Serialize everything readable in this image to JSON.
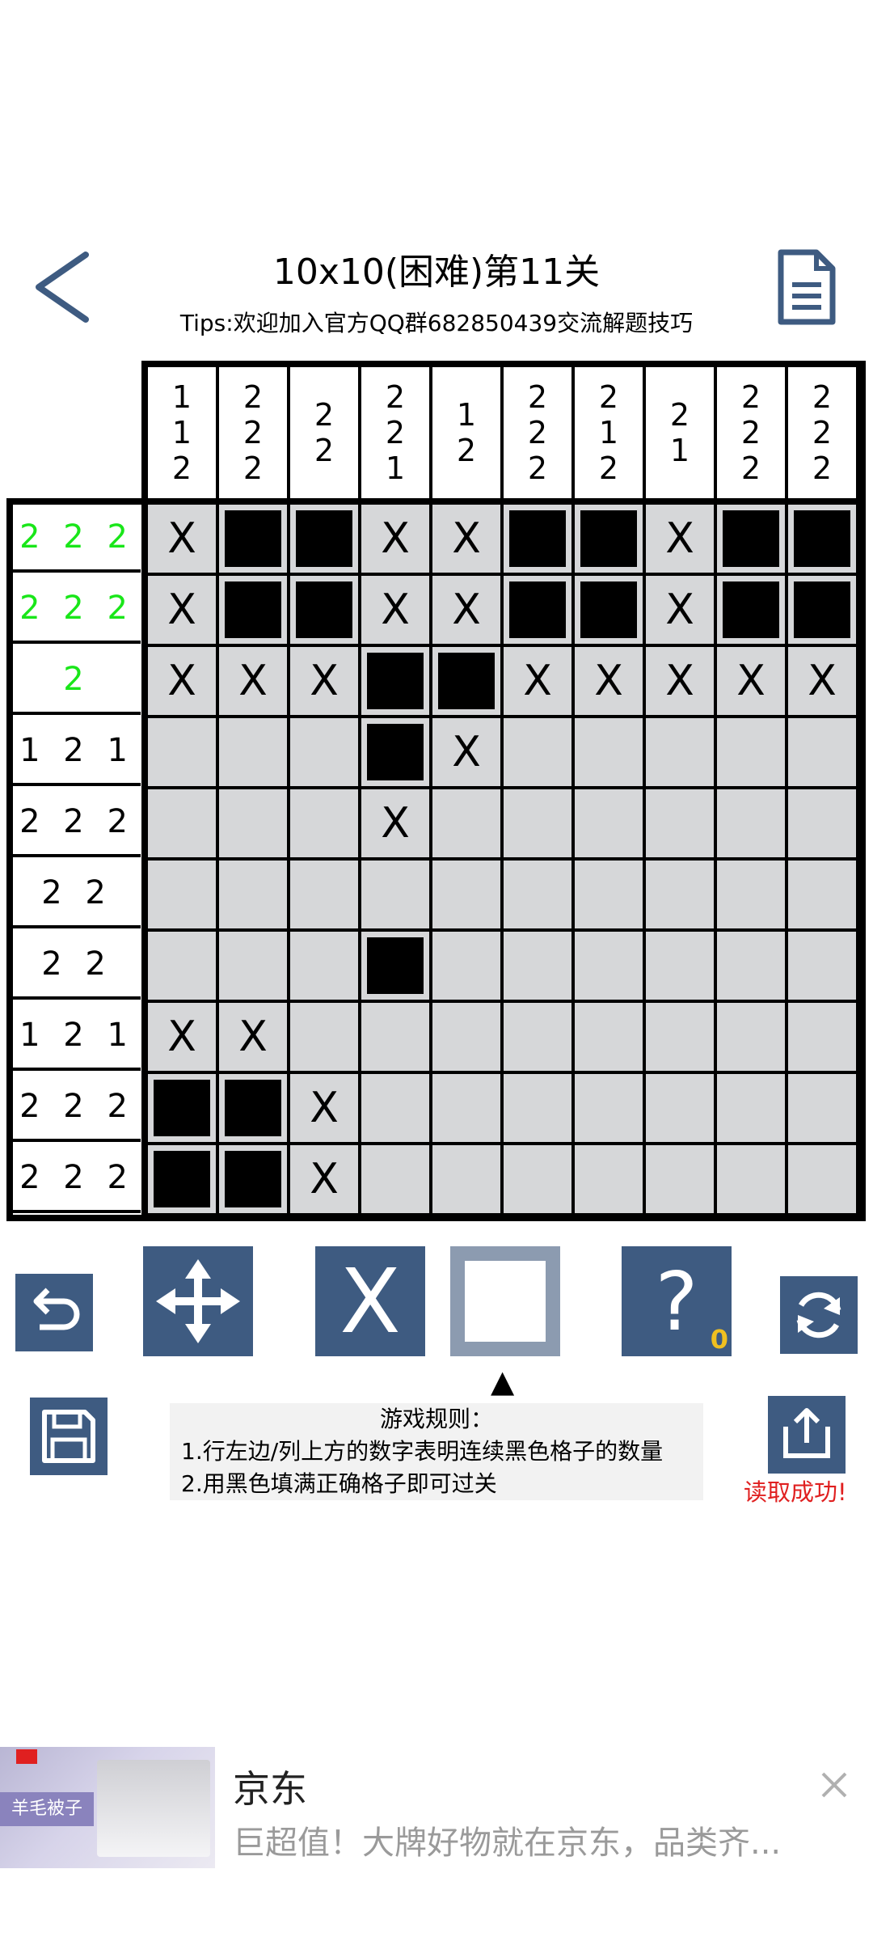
{
  "header": {
    "title": "10x10(困难)第11关",
    "tips": "Tips:欢迎加入官方QQ群682850439交流解题技巧"
  },
  "puzzle": {
    "col_clues": [
      [
        "1",
        "1",
        "2"
      ],
      [
        "2",
        "2",
        "2"
      ],
      [
        "2",
        "2"
      ],
      [
        "2",
        "2",
        "1"
      ],
      [
        "1",
        "2"
      ],
      [
        "2",
        "2",
        "2"
      ],
      [
        "2",
        "1",
        "2"
      ],
      [
        "2",
        "1"
      ],
      [
        "2",
        "2",
        "2"
      ],
      [
        "2",
        "2",
        "2"
      ]
    ],
    "row_clues": [
      "2 2 2",
      "2 2 2",
      "2",
      "1 2 1",
      "2 2 2",
      "2 2",
      "2 2",
      "1 2 1",
      "2 2 2",
      "2 2 2"
    ],
    "row_clue_solved": [
      true,
      true,
      true,
      false,
      false,
      false,
      false,
      false,
      false,
      false
    ],
    "solved_color": "#19e619",
    "cells": [
      "X##XX##X##",
      "X##XX##X##",
      "XXX##XXXXX",
      "...#X.....",
      "...X......",
      "..........",
      "...#......",
      "XX........",
      "##X.......",
      "##X......."
    ],
    "mark_label": "X"
  },
  "toolbar": {
    "x_label": "X",
    "hint_label": "?",
    "hint_count": "0",
    "selected_indicator": "▲",
    "accent": "#3e5b81"
  },
  "rules": {
    "title": "游戏规则：",
    "line1": "1.行左边/列上方的数字表明连续黑色格子的数量",
    "line2": "2.用黑色填满正确格子即可过关"
  },
  "status": {
    "load_message": "读取成功!"
  },
  "ad": {
    "brand_badge": "羊毛被子",
    "title": "京东",
    "description": "巨超值！大牌好物就在京东，品类齐..."
  }
}
